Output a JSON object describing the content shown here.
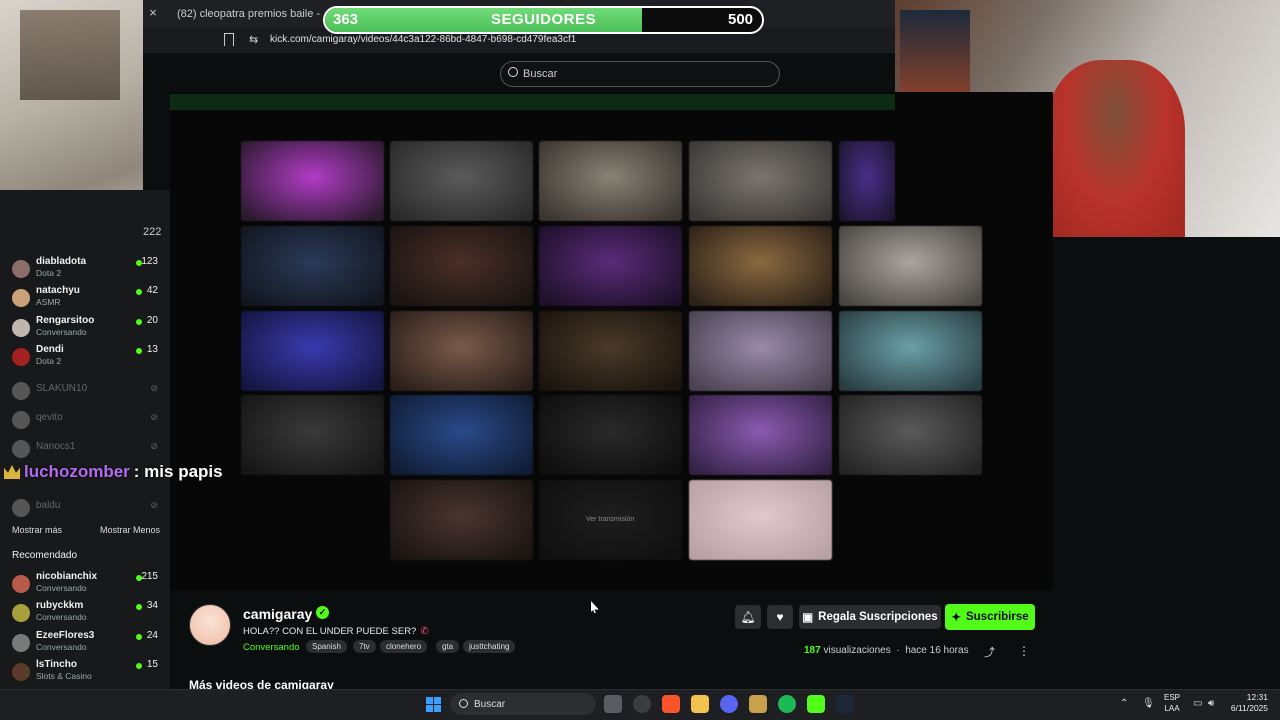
{
  "browser": {
    "yt_tab_title": "(82) cleopatra premios baile - YouTube",
    "close_glyph": "×",
    "url": "kick.com/camigaray/videos/44c3a122-86bd-4847-b698-cd479fea3cf1"
  },
  "follower_goal": {
    "current": "363",
    "label": "SEGUIDORES",
    "goal": "500",
    "progress": 0.726,
    "color": "#4cbf58"
  },
  "search": {
    "placeholder": "Buscar"
  },
  "video": {
    "tile_overlay_label": "Ver transmisión"
  },
  "sidebar": {
    "top_count": "222",
    "followed": [
      {
        "name": "diabladota",
        "game": "Dota 2",
        "viewers": "123",
        "avatar_color": "#8b6d6a"
      },
      {
        "name": "natachyu",
        "game": "ASMR",
        "viewers": "42",
        "avatar_color": "#c9a27a"
      },
      {
        "name": "Rengarsitoo",
        "game": "Conversando",
        "viewers": "20",
        "avatar_color": "#c0b6b0"
      },
      {
        "name": "Dendi",
        "game": "Dota 2",
        "viewers": "13",
        "avatar_color": "#a3211f"
      }
    ],
    "offline": [
      {
        "name": "SLAKUN10"
      },
      {
        "name": "qevito"
      },
      {
        "name": "Nanocs1"
      },
      {
        "name": "baldu"
      }
    ],
    "show_more": "Mostrar más",
    "show_less": "Mostrar Menos",
    "recommended_title": "Recomendado",
    "recommended": [
      {
        "name": "nicobianchix",
        "game": "Conversando",
        "viewers": "215",
        "avatar_color": "#b85a4a"
      },
      {
        "name": "rubyckkm",
        "game": "Conversando",
        "viewers": "34",
        "avatar_color": "#a8a03a"
      },
      {
        "name": "EzeeFlores3",
        "game": "Conversando",
        "viewers": "24",
        "avatar_color": "#7a7a7a"
      },
      {
        "name": "lsTincho",
        "game": "Slots & Casino",
        "viewers": "15",
        "avatar_color": "#5a3a2a"
      }
    ]
  },
  "chat_overlay": {
    "user": "luchozomber",
    "message": ": mis papis"
  },
  "streamer": {
    "name": "camigaray",
    "title": "HOLA?? CON EL UNDER PUEDE SER?",
    "category": "Conversando",
    "tags": [
      "Spanish",
      "7tv",
      "clonehero",
      "gta",
      "justtchating"
    ],
    "views": "187",
    "views_label": "visualizaciones",
    "time_ago": "hace 16 horas",
    "gift_label": "Regala Suscripciones",
    "subscribe_label": "Suscribirse",
    "more_videos": "Más videos de camigaray"
  },
  "taskbar": {
    "search_placeholder": "Buscar",
    "lang_1": "ESP",
    "lang_2": "LAA",
    "time": "12:31",
    "date": "6/11/2025"
  },
  "icons": {
    "bell": "bell-icon",
    "heart": "heart-icon",
    "gift": "gift-icon",
    "share": "share-icon",
    "kebab": "more-options-icon",
    "verified": "verified-icon",
    "phone": "phone-icon"
  }
}
